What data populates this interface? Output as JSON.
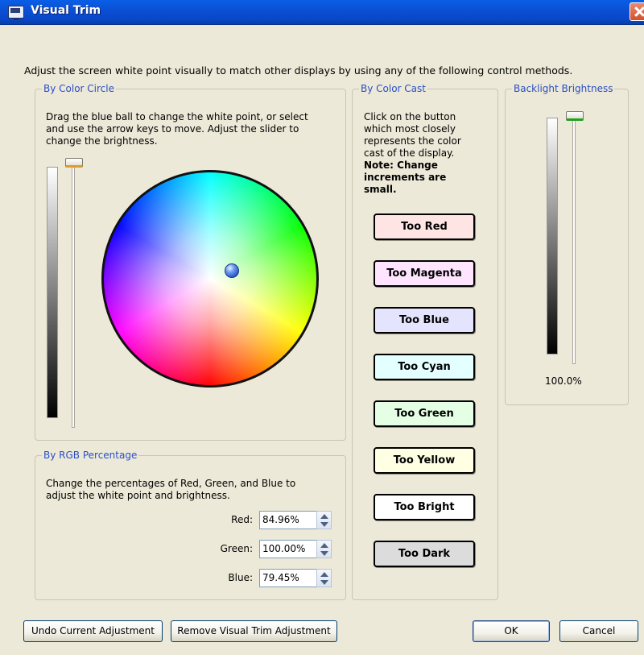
{
  "window": {
    "title": "Visual Trim"
  },
  "intro_text": "Adjust the screen white point visually to match other displays by using any of the following control methods.",
  "color_circle": {
    "legend": "By Color Circle",
    "description_lines": [
      "Drag the blue ball to change the white point, or select",
      "and use the arrow keys to move. Adjust the slider to",
      "change the brightness."
    ]
  },
  "color_cast": {
    "legend": "By Color Cast",
    "description_lines": [
      "Click on the button",
      "which most closely",
      "represents the color",
      "cast of the display."
    ],
    "note_lines": [
      "Note: Change",
      "increments are",
      "small."
    ],
    "buttons": [
      {
        "label": "Too Red",
        "color": "#ffe4e4"
      },
      {
        "label": "Too Magenta",
        "color": "#ffe4ff"
      },
      {
        "label": "Too Blue",
        "color": "#e4e4ff"
      },
      {
        "label": "Too Cyan",
        "color": "#e4ffff"
      },
      {
        "label": "Too Green",
        "color": "#e4ffe4"
      },
      {
        "label": "Too Yellow",
        "color": "#ffffe4"
      },
      {
        "label": "Too Bright",
        "color": "#ffffff"
      },
      {
        "label": "Too Dark",
        "color": "#dcdcdc"
      }
    ]
  },
  "backlight": {
    "legend": "Backlight Brightness",
    "value_label": "100.0%",
    "slider_level": 1.0
  },
  "rgb_percentage": {
    "legend": "By RGB Percentage",
    "description_lines": [
      "Change the percentages of Red, Green, and Blue to",
      "adjust the white point and brightness."
    ],
    "fields": [
      {
        "label": "Red:",
        "value": "84.96%"
      },
      {
        "label": "Green:",
        "value": "100.00%"
      },
      {
        "label": "Blue:",
        "value": "79.45%"
      }
    ]
  },
  "buttons": {
    "undo": "Undo Current Adjustment",
    "remove": "Remove Visual Trim Adjustment",
    "ok": "OK",
    "cancel": "Cancel"
  },
  "colors": {
    "title_bar": "#0a54dd",
    "legend_text": "#2b4ec7",
    "dialog_bg": "#ece9d8"
  }
}
